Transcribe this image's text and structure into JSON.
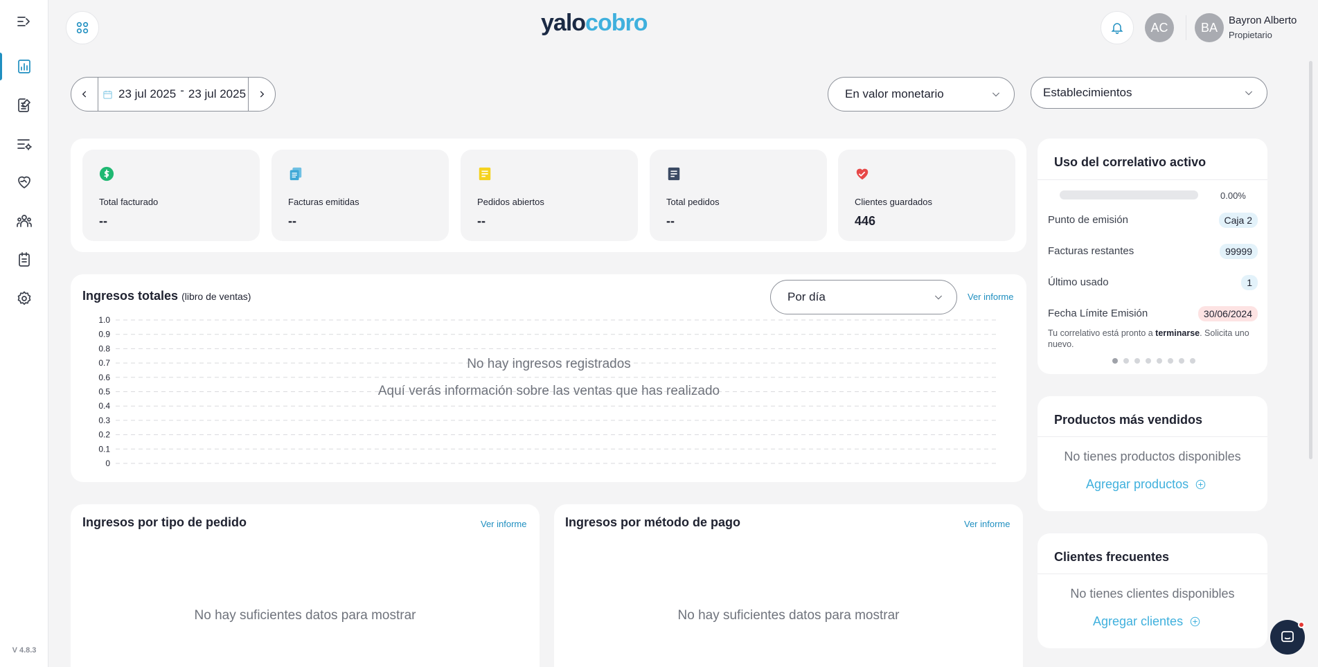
{
  "sidebar": {
    "version": "V 4.8.3",
    "icons": [
      "collapse-menu-icon",
      "dashboard-icon",
      "invoices-icon",
      "settings-list-icon",
      "loyalty-icon",
      "customers-icon",
      "orders-icon",
      "gear-icon"
    ]
  },
  "header": {
    "logo_part1": "yalo",
    "logo_part2": "cobro",
    "avatar_initials": "AC",
    "user_initials": "BA",
    "user_name": "Bayron Alberto",
    "user_role": "Propietario"
  },
  "filters": {
    "date_start": "23 jul 2025",
    "date_separator": "-",
    "date_end": "23 jul 2025",
    "value_mode": "En valor monetario",
    "establishments": "Establecimientos"
  },
  "stats": [
    {
      "label": "Total facturado",
      "value": "--",
      "icon": "dollar-icon",
      "color": "#1fb872"
    },
    {
      "label": "Facturas emitidas",
      "value": "--",
      "icon": "copy-docs-icon",
      "color": "#6fc0e3"
    },
    {
      "label": "Pedidos abiertos",
      "value": "--",
      "icon": "open-order-icon",
      "color": "#f5d21f"
    },
    {
      "label": "Total pedidos",
      "value": "--",
      "icon": "document-icon",
      "color": "#3b4a63"
    },
    {
      "label": "Clientes guardados",
      "value": "446",
      "icon": "heart-hand-icon",
      "color": "#e74848"
    }
  ],
  "income_chart": {
    "title": "Ingresos totales",
    "subtitle": "(libro de ventas)",
    "period": "Por día",
    "link": "Ver informe",
    "empty_title": "No hay ingresos registrados",
    "empty_desc": "Aquí verás información sobre las ventas que has realizado"
  },
  "chart_data": {
    "type": "line",
    "title": "Ingresos totales",
    "ylim": [
      0,
      1
    ],
    "y_ticks": [
      "1.0",
      "0.9",
      "0.8",
      "0.7",
      "0.6",
      "0.5",
      "0.4",
      "0.3",
      "0.2",
      "0.1",
      "0"
    ],
    "series": [],
    "grid": true
  },
  "order_type": {
    "title": "Ingresos por tipo de pedido",
    "link": "Ver informe",
    "empty": "No hay suficientes datos para mostrar"
  },
  "payment_method": {
    "title": "Ingresos por método de pago",
    "link": "Ver informe",
    "empty": "No hay suficientes datos para mostrar"
  },
  "correlative": {
    "title": "Uso del correlativo activo",
    "progress_pct": 0,
    "progress_text": "0.00%",
    "rows": [
      {
        "label": "Punto de emisión",
        "value": "Caja 2"
      },
      {
        "label": "Facturas restantes",
        "value": "99999"
      },
      {
        "label": "Último usado",
        "value": "1"
      },
      {
        "label": "Fecha Límite Emisión",
        "value": "30/06/2024"
      }
    ],
    "notice_pre": "Tu correlativo está pronto a ",
    "notice_bold": "terminarse",
    "notice_post": ". Solicita uno nuevo."
  },
  "top_products": {
    "title": "Productos más vendidos",
    "empty": "No tienes productos disponibles",
    "add": "Agregar productos"
  },
  "frequent_clients": {
    "title": "Clientes frecuentes",
    "empty": "No tienes clientes disponibles",
    "add": "Agregar clientes"
  }
}
